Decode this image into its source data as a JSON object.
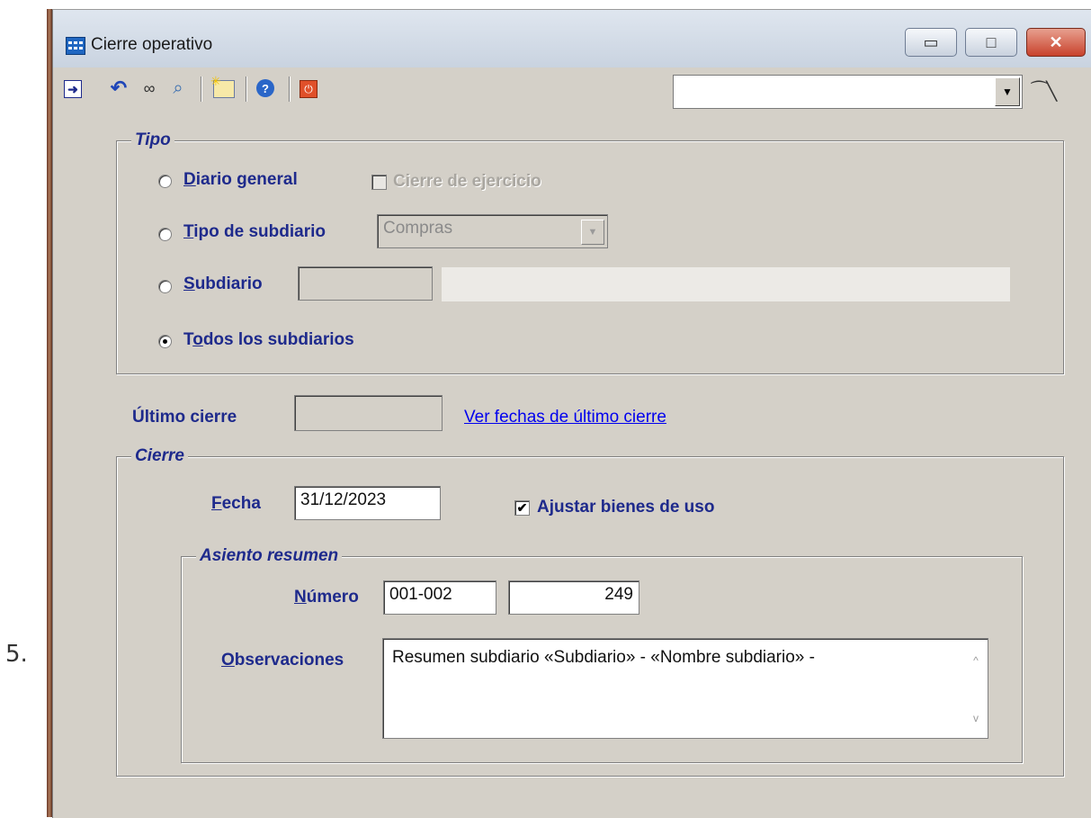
{
  "outer": {
    "prefix": "5."
  },
  "window": {
    "title": "Cierre operativo",
    "buttons": {
      "minimize": "▭",
      "maximize": "□",
      "close": "✕"
    }
  },
  "toolbar": {
    "icons": [
      "enter-icon",
      "undo-icon",
      "binoculars-icon",
      "magnifier-icon",
      "new-record-icon",
      "help-icon",
      "power-icon"
    ],
    "combo_value": ""
  },
  "tipo": {
    "legend": "Tipo",
    "diario_general": {
      "label_pre": "",
      "label_acc": "D",
      "label_post": "iario general",
      "selected": false
    },
    "cierre_ejercicio": {
      "label": "Cierre de ejercicio",
      "checked": false,
      "disabled": true
    },
    "tipo_subdiario": {
      "label_acc": "T",
      "label_post": "ipo de subdiario",
      "selected": false,
      "combo_value": "Compras"
    },
    "subdiario": {
      "label_acc": "S",
      "label_post": "ubdiario",
      "selected": false,
      "code": "",
      "name": ""
    },
    "todos": {
      "label_pre": "T",
      "label_acc": "o",
      "label_post": "dos los subdiarios",
      "selected": true
    }
  },
  "ultimo_cierre": {
    "label": "Último cierre",
    "value": "",
    "link": "Ver fechas de último cierre"
  },
  "cierre": {
    "legend": "Cierre",
    "fecha": {
      "label_acc": "F",
      "label_post": "echa",
      "value": "31/12/2023"
    },
    "ajustar": {
      "label": "Ajustar bienes de uso",
      "checked": true
    }
  },
  "asiento": {
    "legend": "Asiento resumen",
    "numero": {
      "label_acc": "N",
      "label_post": "úmero",
      "serie": "001-002",
      "valor": "249"
    },
    "observaciones": {
      "label_acc": "O",
      "label_post": "bservaciones",
      "value": "Resumen subdiario «Subdiario» - «Nombre subdiario» -"
    }
  }
}
